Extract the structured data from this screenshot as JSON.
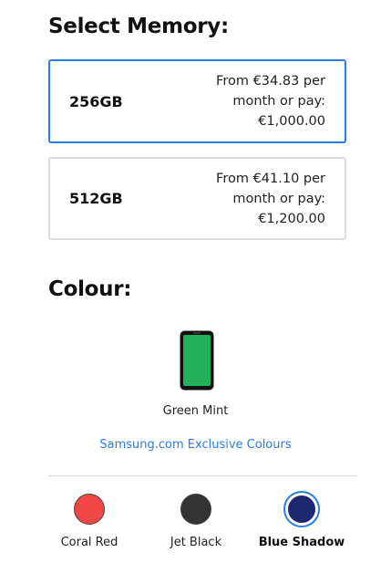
{
  "memory": {
    "title": "Select Memory:",
    "options": [
      {
        "size": "256GB",
        "price_line1": "From €34.83 per",
        "price_line2": "month or pay:",
        "price_line3": "€1,000.00",
        "selected": true
      },
      {
        "size": "512GB",
        "price_line1": "From €41.10 per",
        "price_line2": "month or pay:",
        "price_line3": "€1,200.00",
        "selected": false
      }
    ]
  },
  "colour": {
    "title": "Colour:",
    "preview_name": "Green Mint",
    "preview_color": "#22b05a",
    "exclusive_link": "Samsung.com Exclusive Colours",
    "swatches": [
      {
        "label": "Coral Red",
        "color": "#f04646",
        "selected": false
      },
      {
        "label": "Jet Black",
        "color": "#333333",
        "selected": false
      },
      {
        "label": "Blue Shadow",
        "color": "#1e2870",
        "selected": true
      }
    ]
  },
  "colors": {
    "accent": "#2a7de1",
    "border": "#dcdcdc"
  }
}
